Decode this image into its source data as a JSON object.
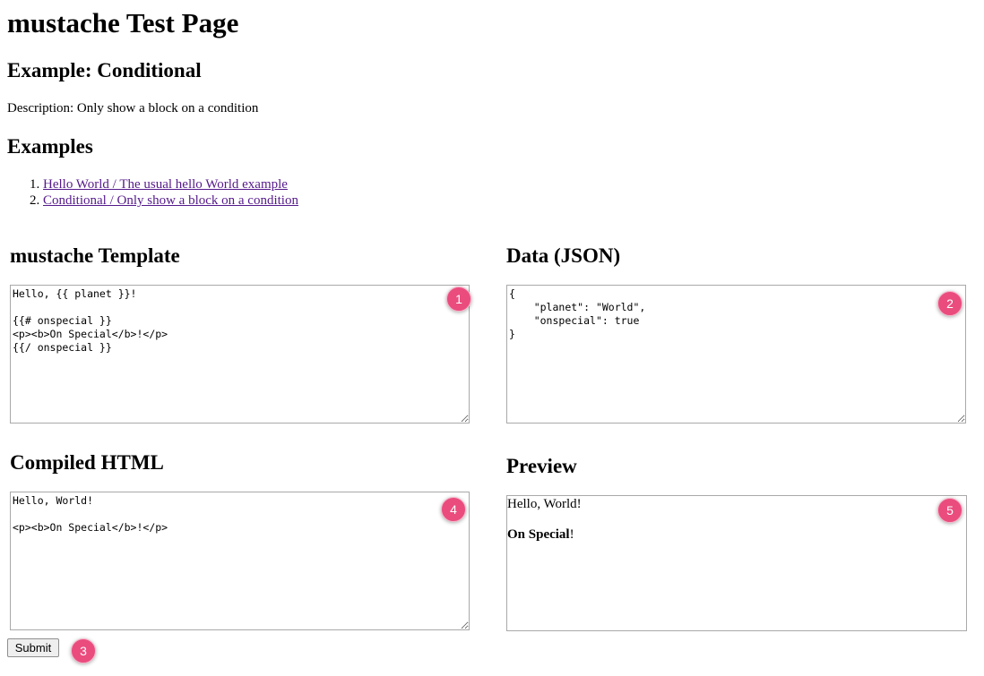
{
  "page": {
    "title": "mustache Test Page",
    "example_heading": "Example: Conditional",
    "description": "Description: Only show a block on a condition",
    "examples_heading": "Examples",
    "examples": [
      {
        "label": "Hello World / The usual hello World example"
      },
      {
        "label": "Conditional / Only show a block on a condition"
      }
    ]
  },
  "template_panel": {
    "heading": "mustache Template",
    "value": "Hello, {{ planet }}!\n\n{{# onspecial }}\n<p><b>On Special</b>!</p>\n{{/ onspecial }}"
  },
  "data_panel": {
    "heading": "Data (JSON)",
    "value": "{\n    \"planet\": \"World\",\n    \"onspecial\": true\n}"
  },
  "compiled_panel": {
    "heading": "Compiled HTML",
    "value": "Hello, World!\n\n<p><b>On Special</b>!</p>"
  },
  "preview_panel": {
    "heading": "Preview",
    "line1": "Hello, World!",
    "bold_text": "On Special",
    "bold_suffix": "!"
  },
  "submit_label": "Submit",
  "badges": [
    "1",
    "2",
    "3",
    "4",
    "5"
  ],
  "colors": {
    "badge": "#ea4c7e",
    "link_visited": "#551a8b"
  }
}
